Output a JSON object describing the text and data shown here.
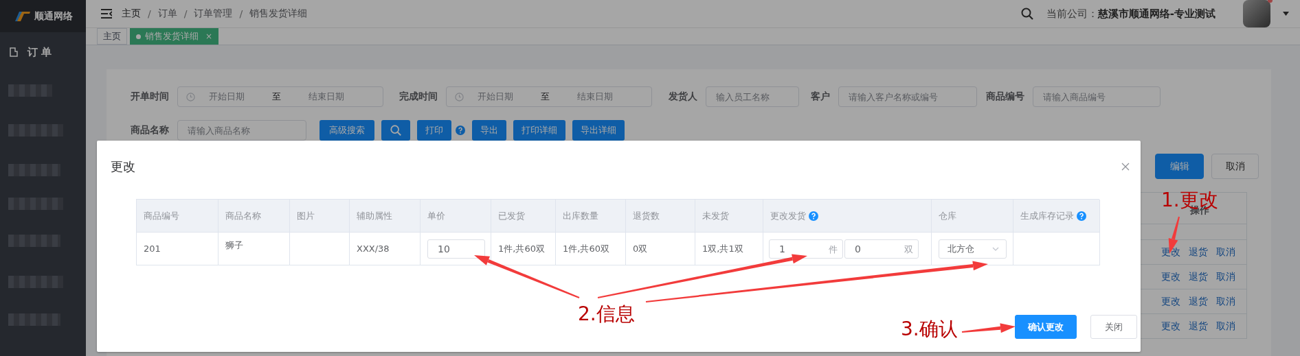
{
  "sidebar": {
    "logo_text": "顺通网络",
    "items": [
      {
        "label": "订 单"
      }
    ]
  },
  "header": {
    "breadcrumb": [
      "主页",
      "订单",
      "订单管理",
      "销售发货详细"
    ],
    "breadcrumb_separator": "/",
    "company": "当前公司：**慈溪市顺通网络-专业测试**"
  },
  "tabs": [
    {
      "label": "主页",
      "selected": false
    },
    {
      "label": "销售发货详细",
      "selected": true,
      "close": "×"
    }
  ],
  "filters": [
    {
      "kind": "daterange",
      "label": "开单时间",
      "start_placeholder": "开始日期",
      "separator": "至",
      "end_placeholder": "结束日期"
    },
    {
      "kind": "daterange",
      "label": "完成时间",
      "start_placeholder": "开始日期",
      "separator": "至",
      "end_placeholder": "结束日期"
    },
    {
      "kind": "text",
      "label": "发货人",
      "placeholder": "输入员工名称"
    },
    {
      "kind": "text",
      "label": "客户",
      "placeholder": "请输入客户名称或编号"
    },
    {
      "kind": "text",
      "label": "商品编号",
      "placeholder": "请输入商品编号"
    },
    {
      "kind": "text",
      "label": "商品名称",
      "placeholder": "请输入商品名称"
    }
  ],
  "toolbar": [
    {
      "kind": "button",
      "label": "高级搜索"
    },
    {
      "kind": "search"
    },
    {
      "kind": "button",
      "label": "打印"
    },
    {
      "kind": "help"
    },
    {
      "kind": "button",
      "label": "导出"
    },
    {
      "kind": "button",
      "label": "打印详细"
    },
    {
      "kind": "button",
      "label": "导出详细"
    }
  ],
  "actions": [
    {
      "kind": "primary",
      "label": "编辑"
    },
    {
      "kind": "default",
      "label": "取消"
    }
  ],
  "operations": {
    "header": "操作",
    "rows": [
      {
        "links": [
          "更改",
          "退货",
          "取消"
        ]
      },
      {
        "links": [
          "更改",
          "退货",
          "取消"
        ]
      },
      {
        "links": [
          "更改",
          "退货",
          "取消"
        ]
      },
      {
        "links": [
          "更改",
          "退货",
          "取消"
        ]
      }
    ]
  },
  "modal": {
    "title": "更改",
    "columns": [
      {
        "label": "商品编号",
        "help": false
      },
      {
        "label": "商品名称",
        "help": false
      },
      {
        "label": "图片",
        "help": false
      },
      {
        "label": "辅助属性",
        "help": false
      },
      {
        "label": "单价",
        "help": false
      },
      {
        "label": "已发货",
        "help": false
      },
      {
        "label": "出库数量",
        "help": false
      },
      {
        "label": "退货数",
        "help": false
      },
      {
        "label": "未发货",
        "help": false
      },
      {
        "label": "更改发货",
        "help": true
      },
      {
        "label": "仓库",
        "help": false
      },
      {
        "label": "生成库存记录",
        "help": true
      }
    ],
    "rows": [
      {
        "code": "201",
        "name": "狮子",
        "attributes": "XXX/38",
        "unit_price": "10",
        "shipped": "1件,共60双",
        "outbound": "1件,共60双",
        "returned": "0双",
        "unshipped": "1双,共1双",
        "change": [
          {
            "value": "1",
            "unit": "件"
          },
          {
            "value": "0",
            "unit": "双"
          }
        ],
        "warehouse": "北方仓"
      }
    ],
    "buttons": [
      {
        "kind": "primary",
        "label": "确认更改"
      },
      {
        "kind": "default",
        "label": "关闭"
      }
    ]
  },
  "annotations": [
    {
      "text": "1.更改"
    },
    {
      "text": "2.信息"
    },
    {
      "text": "3.确认"
    }
  ]
}
